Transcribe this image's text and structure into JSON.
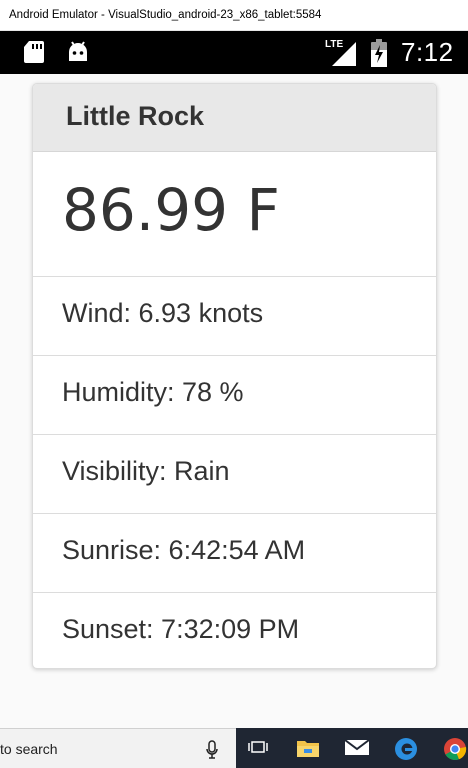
{
  "window": {
    "title": "Android Emulator - VisualStudio_android-23_x86_tablet:5584"
  },
  "status_bar": {
    "network": "LTE",
    "time": "7:12",
    "icons": [
      "sd-card-icon",
      "android-debug-icon",
      "signal-icon",
      "battery-icon"
    ]
  },
  "weather": {
    "city": "Little Rock",
    "temperature": "86.99 F",
    "wind": "Wind: 6.93 knots",
    "humidity": "Humidity: 78 %",
    "visibility": "Visibility: Rain",
    "sunrise": "Sunrise: 6:42:54 AM",
    "sunset": "Sunset: 7:32:09 PM"
  },
  "taskbar": {
    "search_text": "to search",
    "icons": [
      "mic-icon",
      "task-view-icon",
      "file-explorer-icon",
      "mail-icon",
      "edge-icon",
      "chrome-icon"
    ]
  },
  "colors": {
    "status_bar_bg": "#000000",
    "card_header_bg": "#e8e8e8",
    "text": "#333333",
    "taskbar_bg": "#1f2633"
  }
}
